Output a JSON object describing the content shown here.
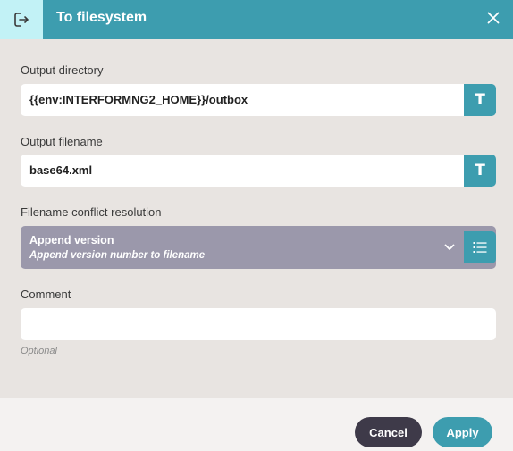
{
  "header": {
    "title": "To filesystem",
    "icon": "exit-icon",
    "close_icon": "close-icon"
  },
  "fields": {
    "output_directory": {
      "label": "Output directory",
      "value": "{{env:INTERFORMNG2_HOME}}/outbox",
      "side_icon": "text-mode-icon"
    },
    "output_filename": {
      "label": "Output filename",
      "value": "base64.xml",
      "side_icon": "text-mode-icon"
    },
    "conflict_resolution": {
      "label": "Filename conflict resolution",
      "selected": "Append version",
      "selected_description": "Append version number to filename",
      "side_icon": "list-icon"
    },
    "comment": {
      "label": "Comment",
      "value": "",
      "hint": "Optional"
    }
  },
  "footer": {
    "cancel_label": "Cancel",
    "apply_label": "Apply"
  },
  "colors": {
    "accent": "#3d9daf",
    "header_icon_bg": "#c2f2f6",
    "select_bg": "#9b98ab",
    "cancel_bg": "#3e3a49",
    "panel_bg": "#e8e4e1"
  }
}
